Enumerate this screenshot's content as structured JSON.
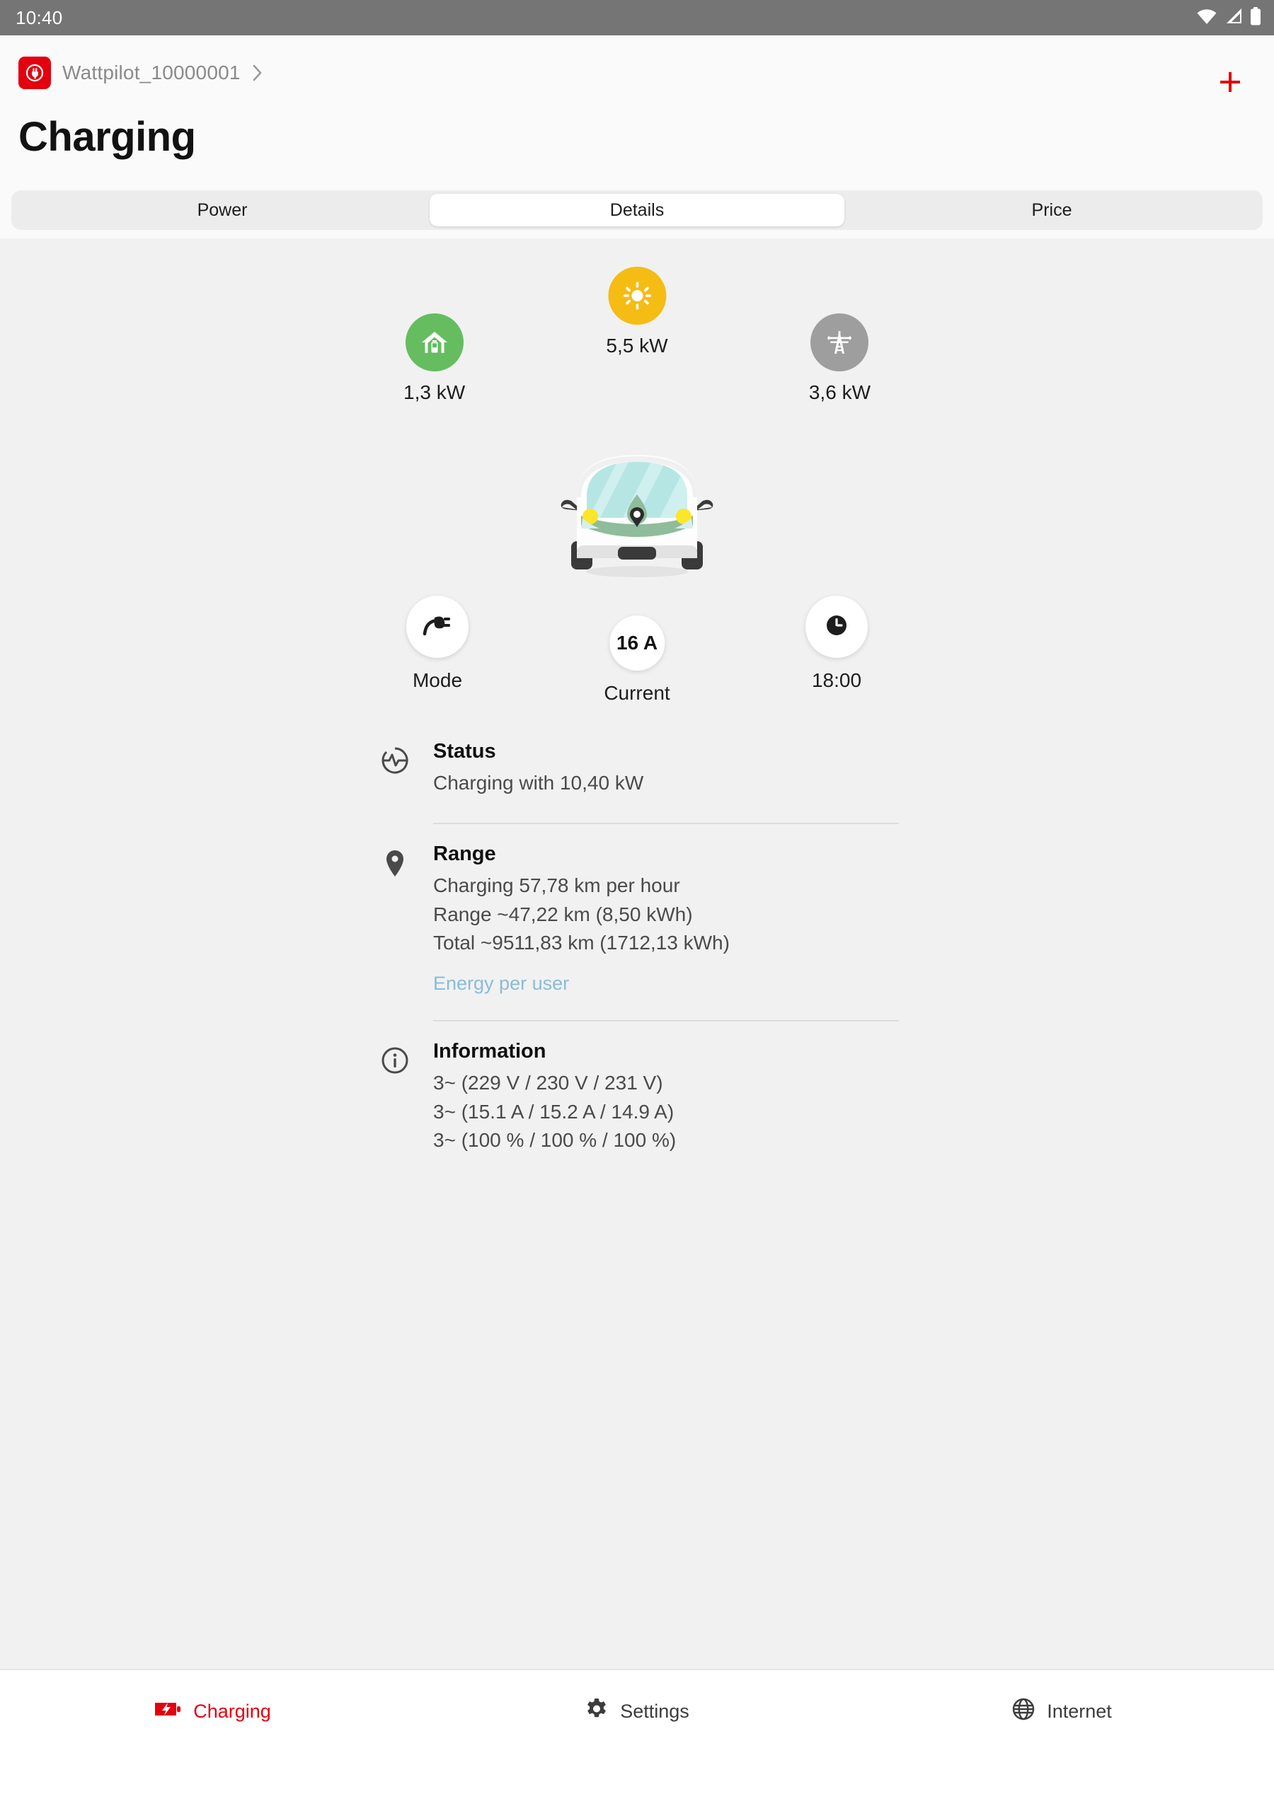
{
  "status_bar": {
    "time": "10:40",
    "icons": [
      "wifi-icon",
      "cellular-signal-icon",
      "battery-icon"
    ]
  },
  "header": {
    "device_icon": "wattpilot-plug-icon",
    "device_name": "Wattpilot_10000001",
    "chevron": "chevron-right-icon",
    "add_label": "+",
    "page_title": "Charging"
  },
  "tabs": [
    {
      "label": "Power",
      "active": false
    },
    {
      "label": "Details",
      "active": true
    },
    {
      "label": "Price",
      "active": false
    }
  ],
  "energy_flow": {
    "house": {
      "icon": "house-battery-icon",
      "value": "1,3 kW",
      "color": "#65BD60"
    },
    "solar": {
      "icon": "sun-icon",
      "value": "5,5 kW",
      "color": "#F5BC14"
    },
    "grid": {
      "icon": "power-pylon-icon",
      "value": "3,6 kW",
      "color": "#9E9E9E"
    },
    "vehicle_icon": "electric-car-front-icon"
  },
  "controls": {
    "mode": {
      "icon": "power-plug-icon",
      "label": "Mode"
    },
    "current": {
      "value": "16 A",
      "label": "Current"
    },
    "timer": {
      "icon": "clock-icon",
      "label": "18:00"
    }
  },
  "sections": {
    "status": {
      "icon": "activity-pulse-icon",
      "title": "Status",
      "lines": [
        "Charging with 10,40 kW"
      ]
    },
    "range": {
      "icon": "map-pin-icon",
      "title": "Range",
      "lines": [
        "Charging 57,78 km per hour",
        "Range ~47,22 km (8,50 kWh)",
        "Total ~9511,83 km (1712,13 kWh)"
      ],
      "link": "Energy per user"
    },
    "information": {
      "icon": "info-circle-icon",
      "title": "Information",
      "lines": [
        "3~ (229 V / 230 V / 231 V)",
        "3~ (15.1 A / 15.2 A / 14.9 A)",
        "3~ (100 % / 100 % / 100 %)"
      ]
    }
  },
  "bottom_nav": [
    {
      "label": "Charging",
      "icon": "battery-charging-icon",
      "active": true
    },
    {
      "label": "Settings",
      "icon": "gear-icon",
      "active": false
    },
    {
      "label": "Internet",
      "icon": "globe-icon",
      "active": false
    }
  ],
  "colors": {
    "brand_red": "#E3000F",
    "link_blue": "#89BCD8",
    "house_green": "#65BD60",
    "solar_amber": "#F5BC14",
    "grid_gray": "#9E9E9E"
  }
}
